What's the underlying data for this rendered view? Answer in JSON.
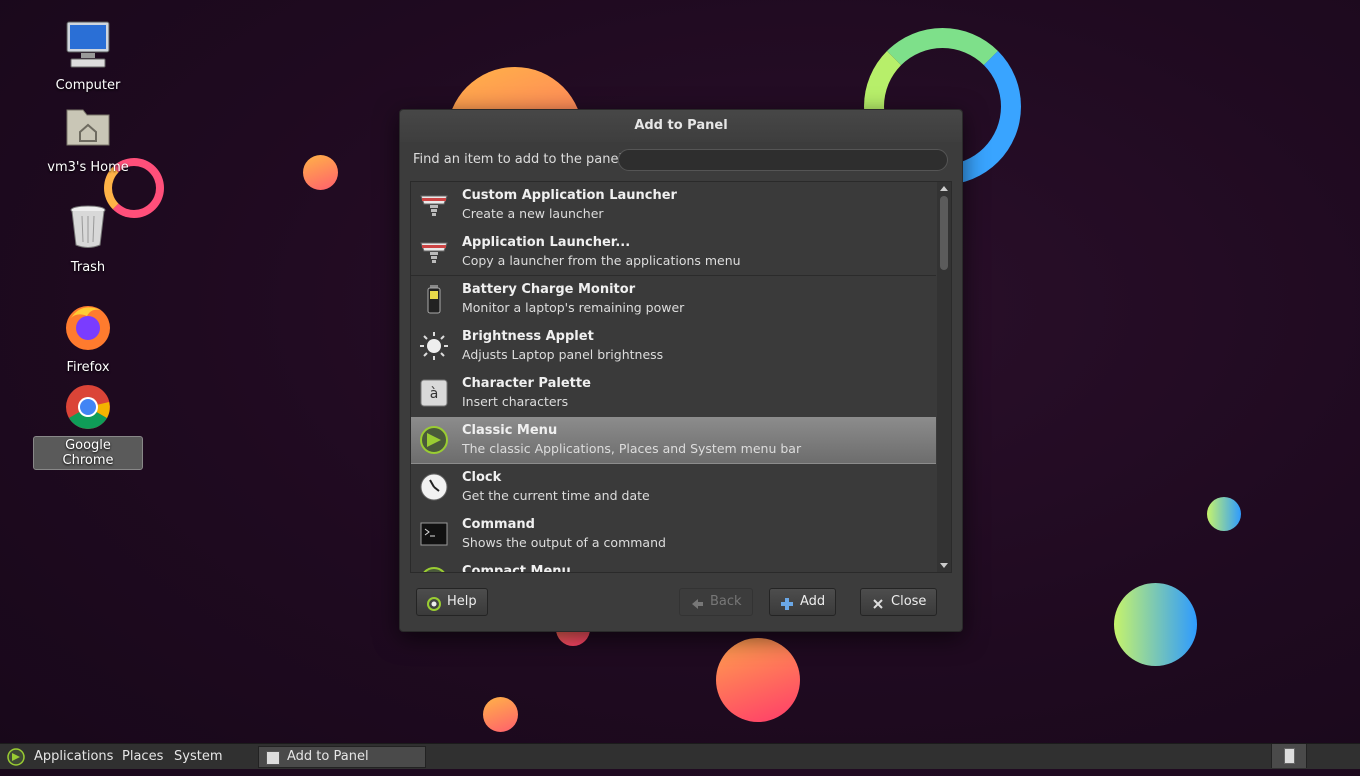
{
  "desktop": {
    "icons": [
      {
        "label": "Computer",
        "icon": "computer-icon"
      },
      {
        "label": "vm3's Home",
        "icon": "home-folder-icon"
      },
      {
        "label": "Trash",
        "icon": "trash-icon"
      },
      {
        "label": "Firefox",
        "icon": "firefox-icon"
      },
      {
        "label": "Google Chrome",
        "icon": "chrome-icon",
        "selected": true
      }
    ]
  },
  "dialog": {
    "title": "Add to Panel",
    "find_label": "Find an item to add to the panel:",
    "find_value": "",
    "items": [
      {
        "name": "Custom Application Launcher",
        "desc": "Create a new launcher",
        "icon": "launcher-icon"
      },
      {
        "name": "Application Launcher...",
        "desc": "Copy a launcher from the applications menu",
        "icon": "launcher-icon"
      },
      {
        "name": "Battery Charge Monitor",
        "desc": "Monitor a laptop's remaining power",
        "icon": "battery-icon"
      },
      {
        "name": "Brightness Applet",
        "desc": "Adjusts Laptop panel brightness",
        "icon": "brightness-icon"
      },
      {
        "name": "Character Palette",
        "desc": "Insert characters",
        "icon": "character-palette-icon"
      },
      {
        "name": "Classic Menu",
        "desc": "The classic Applications, Places and System menu bar",
        "icon": "classic-menu-icon",
        "selected": true
      },
      {
        "name": "Clock",
        "desc": "Get the current time and date",
        "icon": "clock-icon"
      },
      {
        "name": "Command",
        "desc": "Shows the output of a command",
        "icon": "terminal-icon"
      },
      {
        "name": "Compact Menu",
        "desc": "",
        "icon": "classic-menu-icon"
      }
    ],
    "buttons": {
      "help": "Help",
      "back": "Back",
      "add": "Add",
      "close": "Close"
    }
  },
  "panel": {
    "menus": [
      "Applications",
      "Places",
      "System"
    ],
    "task": "Add to Panel"
  },
  "colors": {
    "desktop_bg": "#1f0a20",
    "dialog_bg": "#3c3c3c",
    "selected_row": "#7a7a7a",
    "panel_bg": "#303030"
  }
}
